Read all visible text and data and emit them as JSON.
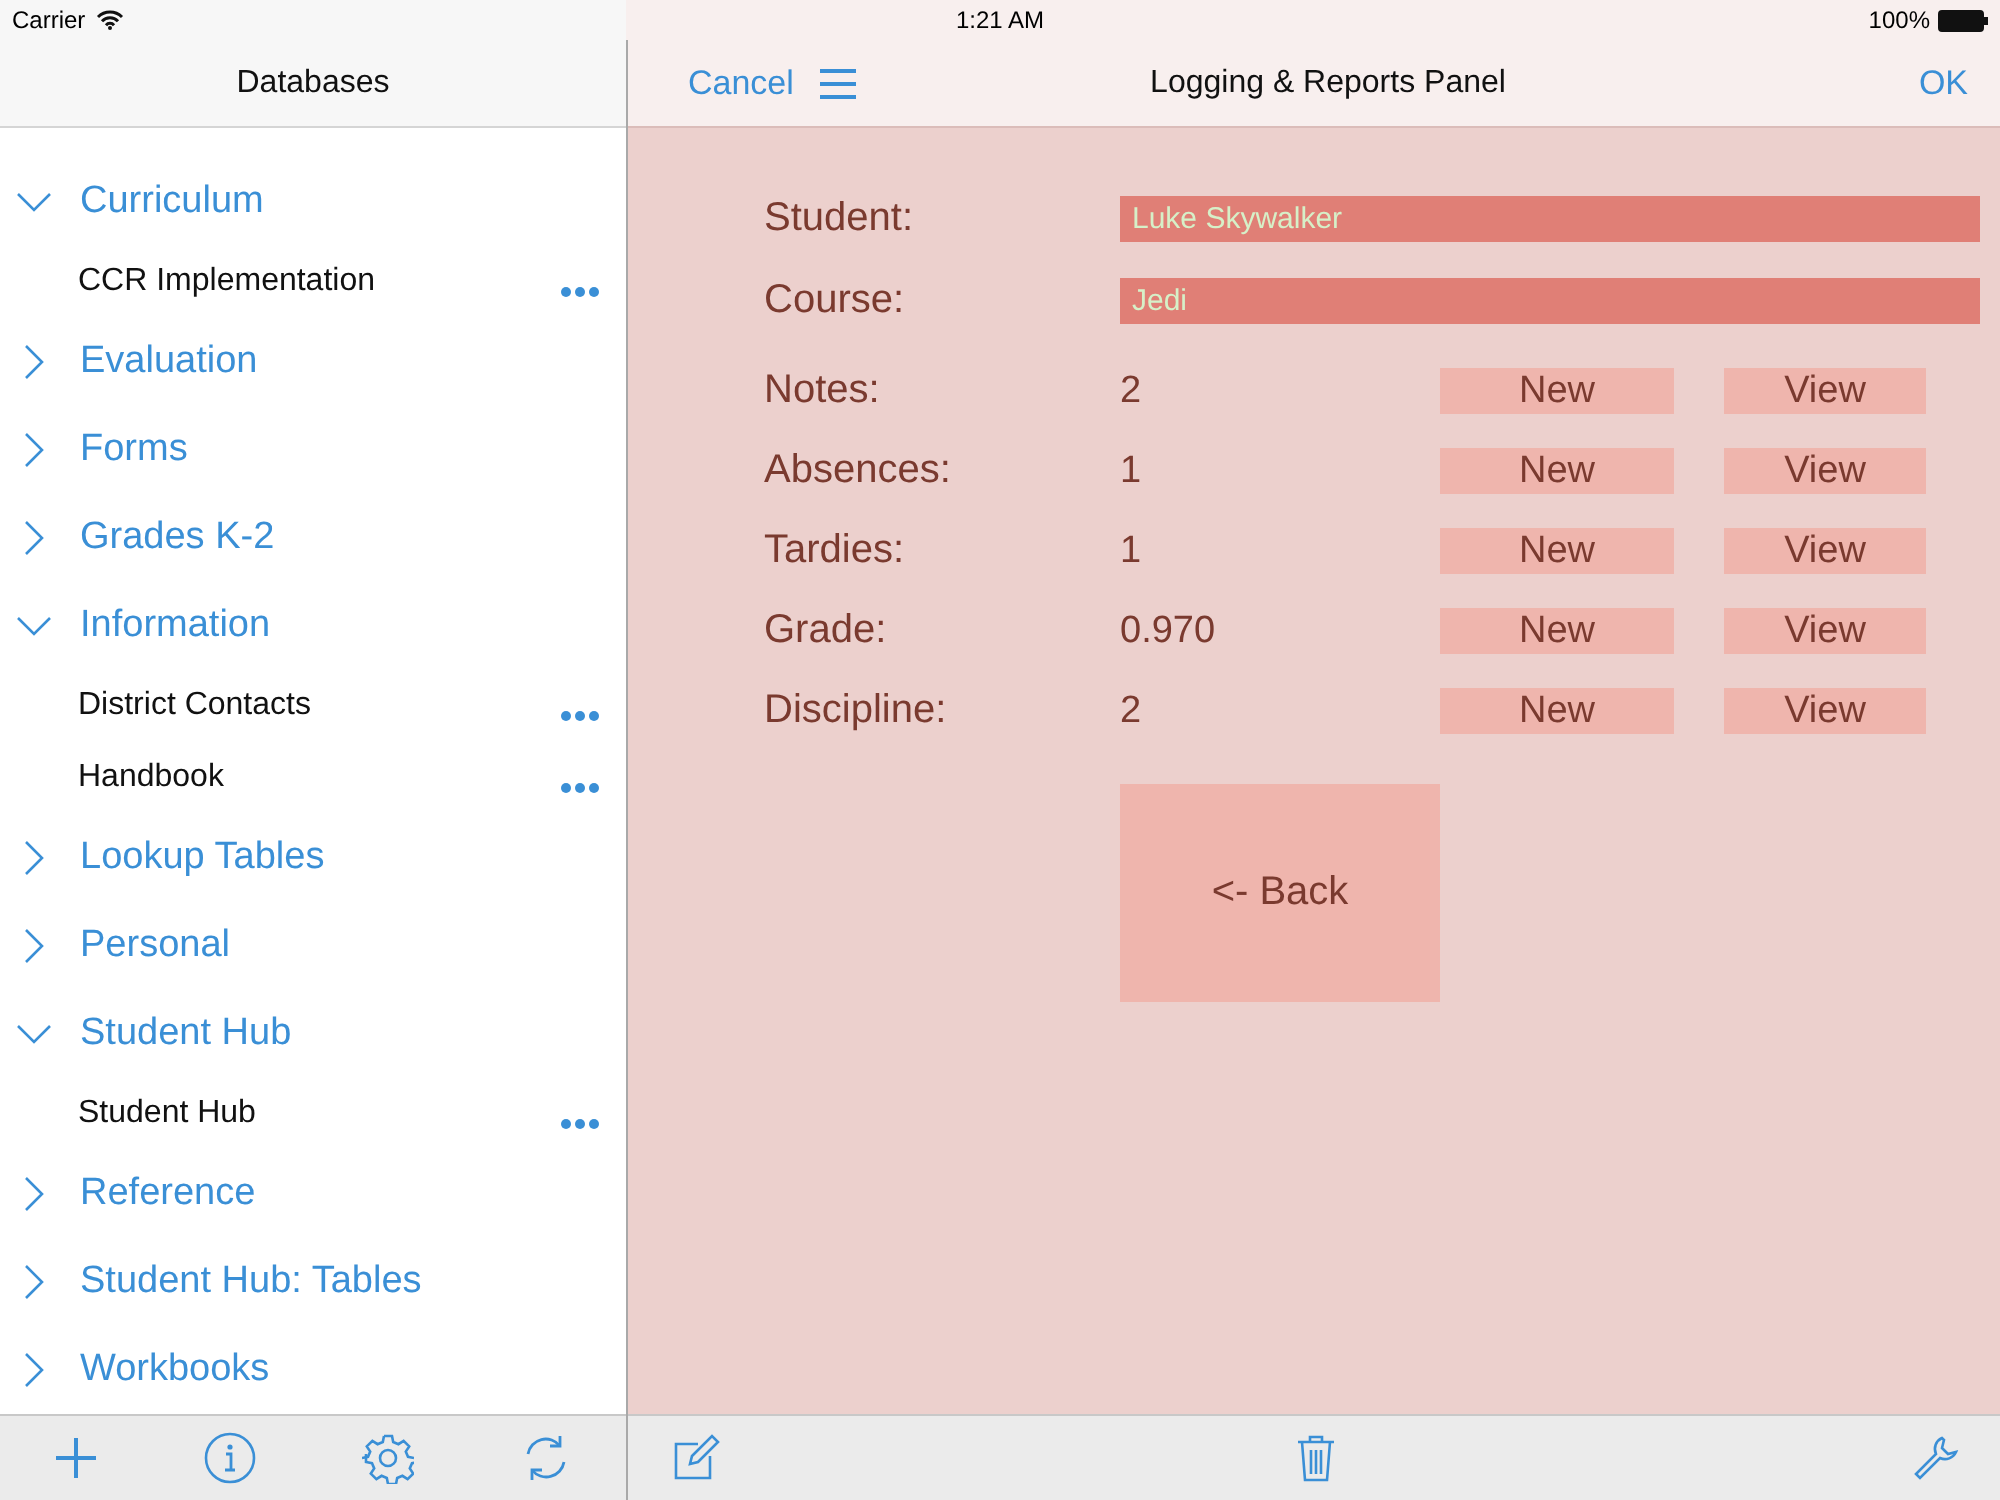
{
  "status_bar": {
    "carrier": "Carrier",
    "time": "1:21 AM",
    "battery": "100%"
  },
  "sidebar": {
    "title": "Databases",
    "items": [
      {
        "label": "Curriculum",
        "expanded": true,
        "children": [
          {
            "label": "CCR Implementation"
          }
        ]
      },
      {
        "label": "Evaluation",
        "expanded": false
      },
      {
        "label": "Forms",
        "expanded": false
      },
      {
        "label": "Grades K-2",
        "expanded": false
      },
      {
        "label": "Information",
        "expanded": true,
        "children": [
          {
            "label": "District Contacts"
          },
          {
            "label": "Handbook"
          }
        ]
      },
      {
        "label": "Lookup Tables",
        "expanded": false
      },
      {
        "label": "Personal",
        "expanded": false
      },
      {
        "label": "Student Hub",
        "expanded": true,
        "children": [
          {
            "label": "Student Hub"
          }
        ]
      },
      {
        "label": "Reference",
        "expanded": false
      },
      {
        "label": "Student Hub: Tables",
        "expanded": false
      },
      {
        "label": "Workbooks",
        "expanded": false
      }
    ]
  },
  "panel": {
    "cancel": "Cancel",
    "title": "Logging & Reports Panel",
    "ok": "OK",
    "fields": [
      {
        "label": "Student:",
        "value": "Luke Skywalker"
      },
      {
        "label": "Course:",
        "value": "Jedi"
      }
    ],
    "records": [
      {
        "label": "Notes:",
        "count": "2",
        "new": "New",
        "view": "View"
      },
      {
        "label": "Absences:",
        "count": "1",
        "new": "New",
        "view": "View"
      },
      {
        "label": "Tardies:",
        "count": "1",
        "new": "New",
        "view": "View"
      },
      {
        "label": "Grade:",
        "count": "0.970",
        "new": "New",
        "view": "View"
      },
      {
        "label": "Discipline:",
        "count": "2",
        "new": "New",
        "view": "View"
      }
    ],
    "back": "<- Back"
  }
}
